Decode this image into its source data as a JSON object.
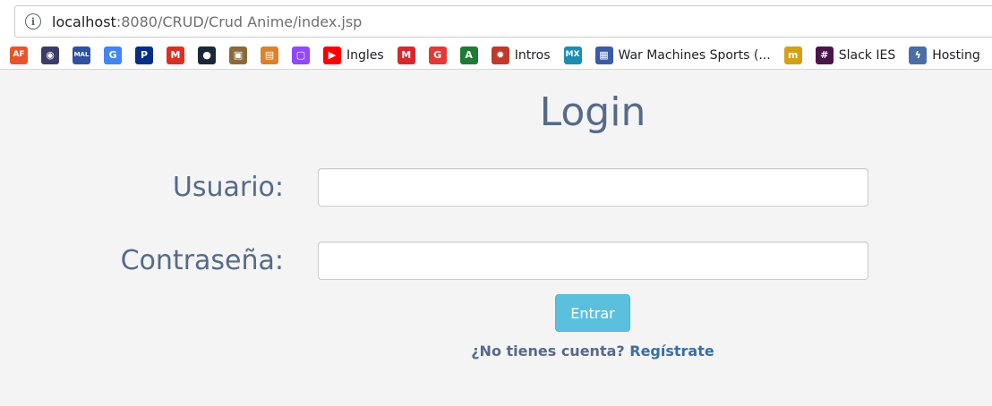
{
  "browser": {
    "url_host": "localhost",
    "url_rest": ":8080/CRUD/Crud Anime/index.jsp"
  },
  "bookmarks": [
    {
      "icon": "animeflv-icon",
      "glyph": "AF",
      "label": "",
      "color": "#e8542b"
    },
    {
      "icon": "anime-site-icon",
      "glyph": "◉",
      "label": "",
      "color": "#3c3c6a"
    },
    {
      "icon": "myanimelist-icon",
      "glyph": "MAL",
      "label": "",
      "color": "#2e51a2"
    },
    {
      "icon": "google-icon",
      "glyph": "G",
      "label": "",
      "color": "#4285f4"
    },
    {
      "icon": "paypal-icon",
      "glyph": "P",
      "label": "",
      "color": "#003087"
    },
    {
      "icon": "gmail-icon",
      "glyph": "M",
      "label": "",
      "color": "#d93025"
    },
    {
      "icon": "steam-icon",
      "glyph": "●",
      "label": "",
      "color": "#1b2838"
    },
    {
      "icon": "box-icon",
      "glyph": "▣",
      "label": "",
      "color": "#8a6a3a"
    },
    {
      "icon": "tracker-icon",
      "glyph": "▤",
      "label": "",
      "color": "#d9822b"
    },
    {
      "icon": "twitch-icon",
      "glyph": "▢",
      "label": "",
      "color": "#9146ff"
    },
    {
      "icon": "youtube-icon",
      "glyph": "▶",
      "label": "Ingles",
      "color": "#ff0000"
    },
    {
      "icon": "mega-icon",
      "glyph": "M",
      "label": "",
      "color": "#d9272e"
    },
    {
      "icon": "red-g-icon",
      "glyph": "G",
      "label": "",
      "color": "#e53935"
    },
    {
      "icon": "terminal-icon",
      "glyph": "A",
      "label": "",
      "color": "#1e7b34"
    },
    {
      "icon": "gear-icon",
      "glyph": "✹",
      "label": "Intros",
      "color": "#c0392b"
    },
    {
      "icon": "mx-icon",
      "glyph": "MX",
      "label": "",
      "color": "#1b8fb0"
    },
    {
      "icon": "trello-icon",
      "glyph": "▦",
      "label": "War Machines Sports (...",
      "color": "#3b5ba5"
    },
    {
      "icon": "m-icon",
      "glyph": "m",
      "label": "",
      "color": "#d4a017"
    },
    {
      "icon": "slack-icon",
      "glyph": "#",
      "label": "Slack IES",
      "color": "#4a154b"
    },
    {
      "icon": "hosting-icon",
      "glyph": "ϟ",
      "label": "Hosting",
      "color": "#4a6fa5"
    },
    {
      "icon": "eye-icon",
      "glyph": "◉",
      "label": "",
      "color": "#1f6fb2"
    }
  ],
  "page": {
    "title": "Login",
    "username_label": "Usuario:",
    "password_label": "Contraseña:",
    "submit_label": "Entrar",
    "signup_prompt": "¿No tienes cuenta?",
    "signup_link": "Regístrate"
  },
  "colors": {
    "heading": "#566a8a",
    "button": "#5bc0de",
    "link": "#3a6ea5",
    "background": "#f4f4f4"
  }
}
